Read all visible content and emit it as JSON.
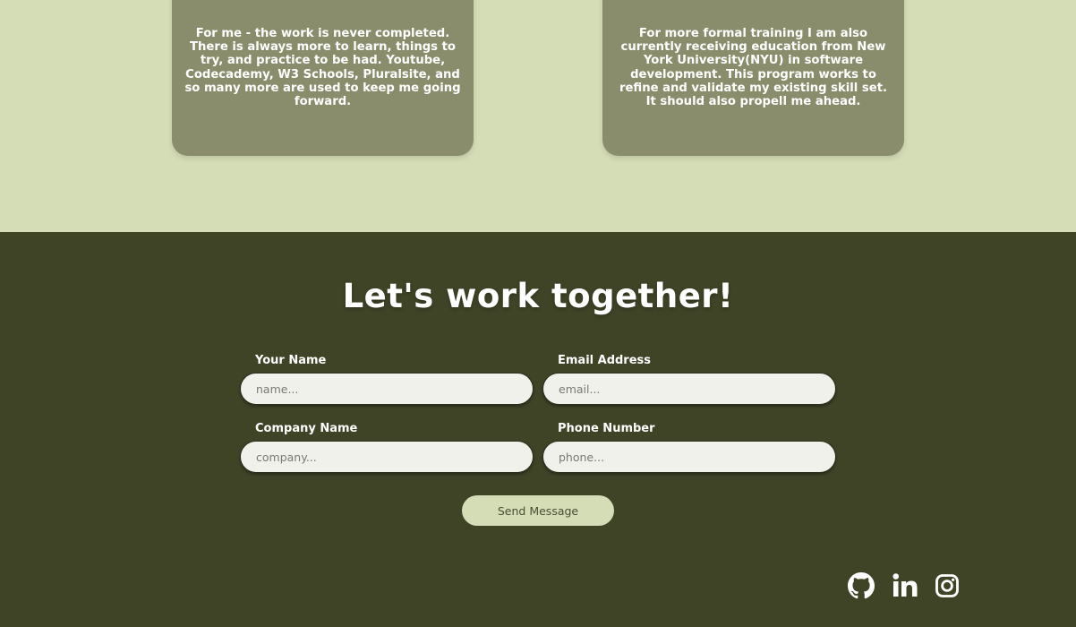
{
  "about": {
    "cards": [
      {
        "text": "For me - the work is never completed. There is always more to learn, things to try, and practice to be had. Youtube, Codecademy, W3 Schools, Pluralsite, and so many more are used to keep me going forward."
      },
      {
        "text": "For more formal training I am also currently receiving education from New York University(NYU) in software development. This program works to refine and validate my existing skill set. It should also propell me ahead."
      }
    ]
  },
  "contact": {
    "title": "Let's work together!",
    "fields": {
      "name": {
        "label": "Your Name",
        "placeholder": "name..."
      },
      "email": {
        "label": "Email Address",
        "placeholder": "email..."
      },
      "company": {
        "label": "Company Name",
        "placeholder": "company..."
      },
      "phone": {
        "label": "Phone Number",
        "placeholder": "phone..."
      }
    },
    "submit_label": "Send Message"
  },
  "social": {
    "icons": [
      "github-icon",
      "linkedin-icon",
      "instagram-icon"
    ]
  },
  "colors": {
    "page_background": "#d5ddb7",
    "card_background": "#898d6c",
    "contact_background": "#3f4427",
    "input_background": "#f1f1ec",
    "button_background": "#d5ddb7"
  }
}
